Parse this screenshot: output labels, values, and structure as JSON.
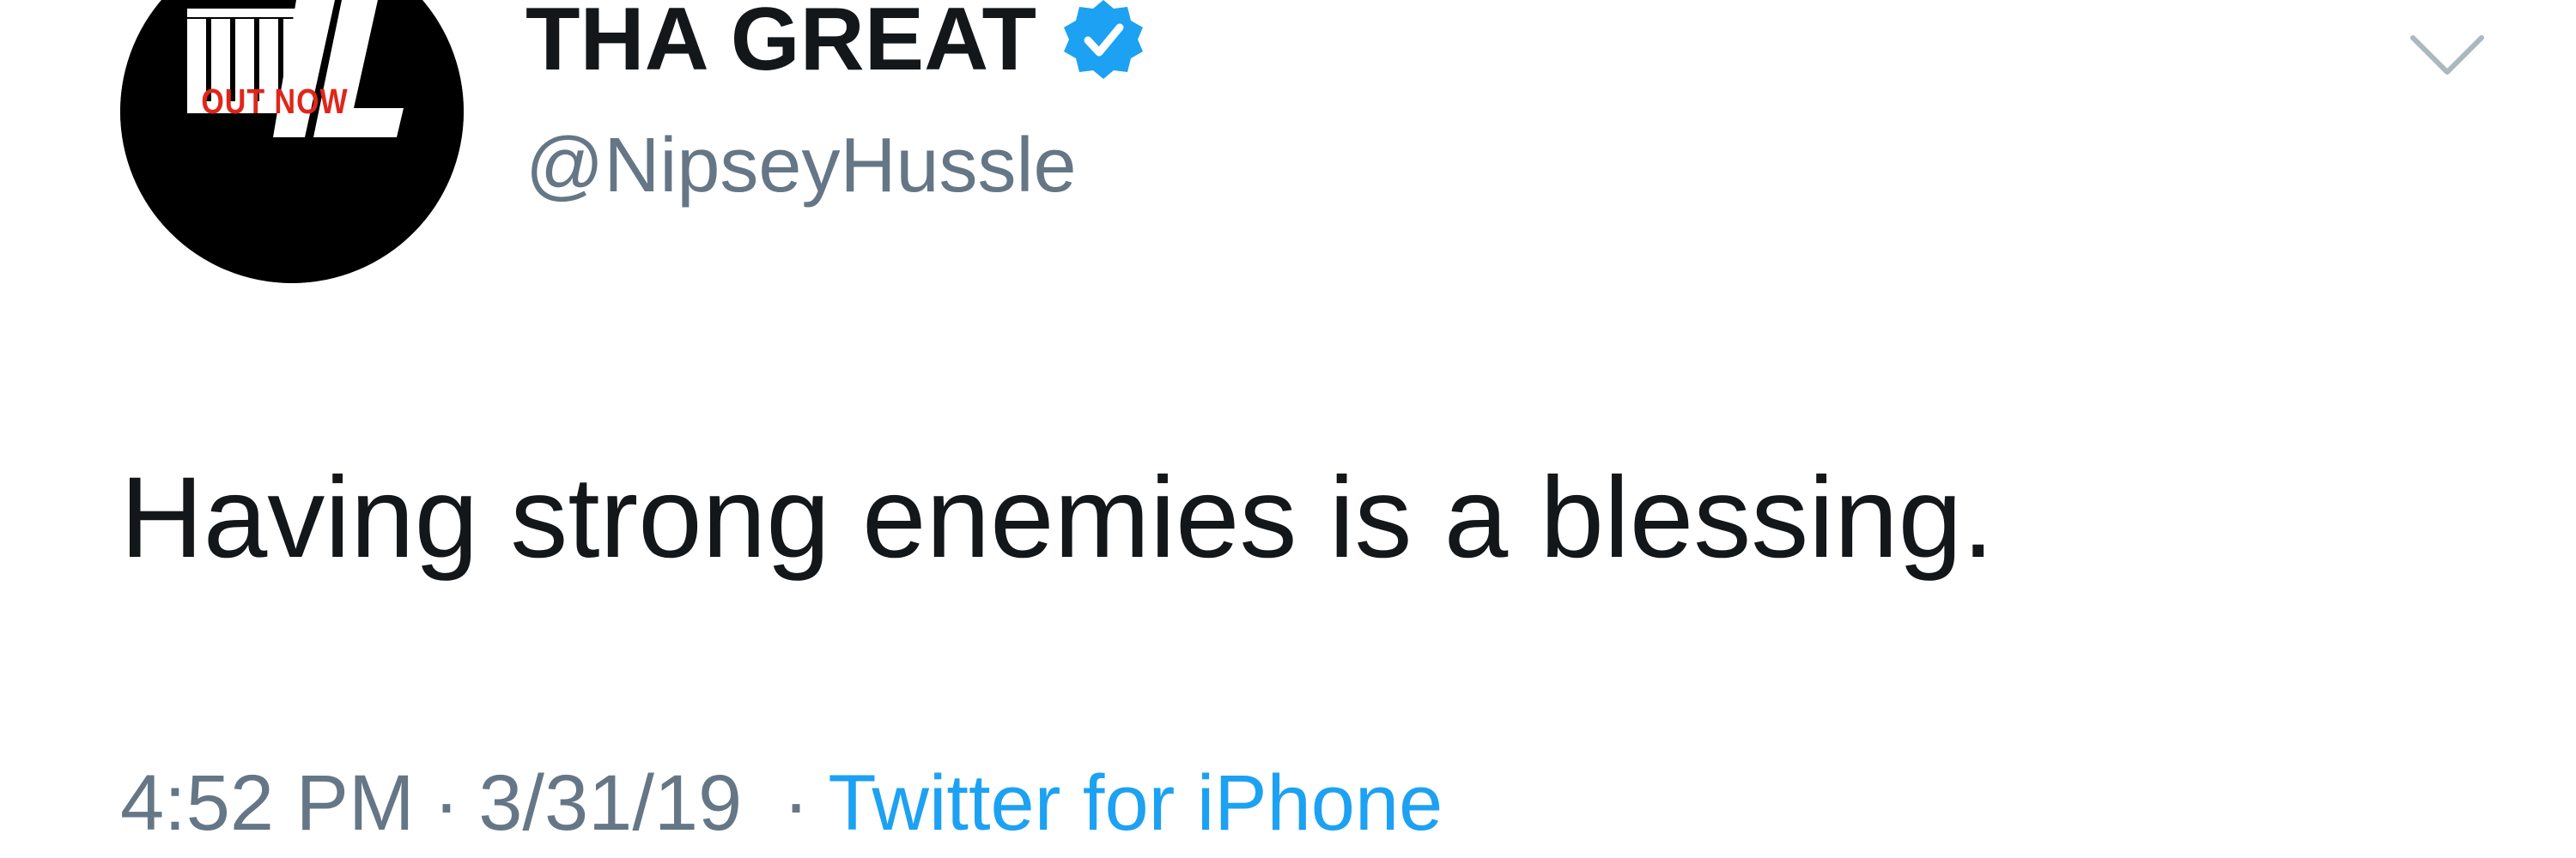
{
  "author": {
    "display_name": "THA GREAT",
    "handle": "@NipseyHussle",
    "verified": true,
    "avatar": {
      "logo_text": "VL",
      "badge_text": "OUT NOW",
      "badge_color": "#e0261b"
    }
  },
  "tweet": {
    "text": "Having strong enemies is a blessing.",
    "time": "4:52 PM",
    "date": "3/31/19",
    "separator": "·",
    "source": "Twitter for iPhone"
  },
  "colors": {
    "text_primary": "#14171a",
    "text_secondary": "#657786",
    "link": "#1da1f2",
    "verified": "#1da1f2",
    "background": "#ffffff"
  },
  "icons": {
    "verified": "verified-badge-icon",
    "menu": "chevron-down-icon"
  }
}
